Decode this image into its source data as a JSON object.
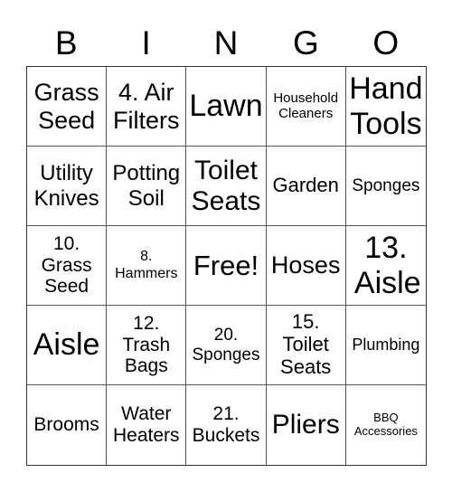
{
  "header": [
    "B",
    "I",
    "N",
    "G",
    "O"
  ],
  "cells": [
    "Grass Seed",
    "4. Air Filters",
    "Lawn",
    "Household Cleaners",
    "Hand Tools",
    "Utility Knives",
    "Potting Soil",
    "Toilet Seats",
    "Garden",
    "Sponges",
    "10. Grass Seed",
    "8. Hammers",
    "Free!",
    "Hoses",
    "13. Aisle",
    "Aisle",
    "12. Trash Bags",
    "20. Sponges",
    "15. Toilet Seats",
    "Plumbing",
    "Brooms",
    "Water Heaters",
    "21. Buckets",
    "Pliers",
    "BBQ Accessories"
  ]
}
